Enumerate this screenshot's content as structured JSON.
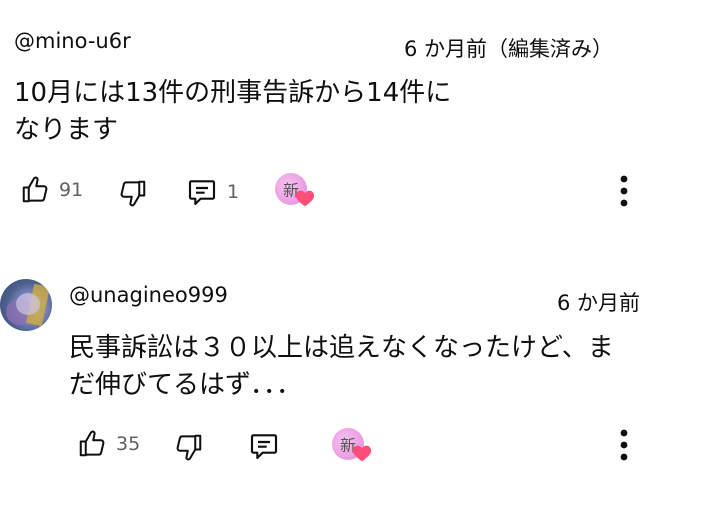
{
  "comments": [
    {
      "handle": "@mino-u6r",
      "timestamp": "6 か月前（編集済み）",
      "lines": [
        "10月には13件の刑事告訴から14件に",
        "なります"
      ],
      "likes": "91",
      "replies": "1",
      "creator_badge_char": "新"
    },
    {
      "handle": "@unagineo999",
      "timestamp": "6 か月前",
      "lines": [
        "民事訴訟は３０以上は追えなくなったけど、ま",
        "だ伸びてるはず．．．"
      ],
      "likes": "35",
      "replies": "",
      "creator_badge_char": "新"
    }
  ],
  "colors": {
    "text": "#0f0f0f",
    "meta": "#606060",
    "heart": "#ff4e7a"
  },
  "icons": [
    "thumbs-up-icon",
    "thumbs-down-icon",
    "comment-icon",
    "creator-heart-icon",
    "more-vert-icon"
  ]
}
